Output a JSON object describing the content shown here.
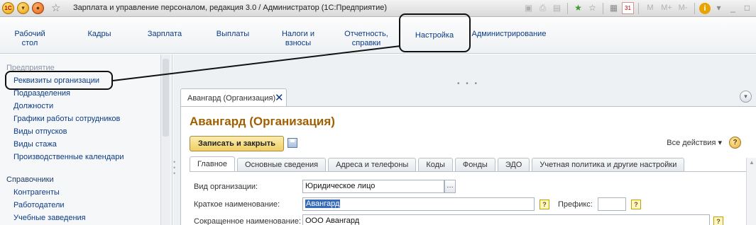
{
  "window": {
    "logo_text": "1С",
    "title": "Зарплата и управление персоналом, редакция 3.0 / Администратор  (1С:Предприятие)",
    "toolbar_m_labels": [
      "M",
      "M+",
      "M-"
    ]
  },
  "sections": [
    {
      "label_line1": "Рабочий",
      "label_line2": "стол"
    },
    {
      "label_line1": "Кадры",
      "label_line2": ""
    },
    {
      "label_line1": "Зарплата",
      "label_line2": ""
    },
    {
      "label_line1": "Выплаты",
      "label_line2": ""
    },
    {
      "label_line1": "Налоги и",
      "label_line2": "взносы"
    },
    {
      "label_line1": "Отчетность,",
      "label_line2": "справки"
    },
    {
      "label_line1": "Настройка",
      "label_line2": ""
    },
    {
      "label_line1": "Администрирование",
      "label_line2": ""
    }
  ],
  "nav": {
    "group1": "Предприятие",
    "items1": [
      "Реквизиты организации",
      "Подразделения",
      "Должности",
      "Графики работы сотрудников",
      "Виды отпусков",
      "Виды стажа",
      "Производственные календари"
    ],
    "group2": "Справочники",
    "items2": [
      "Контрагенты",
      "Работодатели",
      "Учебные заведения"
    ]
  },
  "document": {
    "tab_label": "Авангард (Организация)",
    "title": "Авангард (Организация)",
    "save_close_label": "Записать и закрыть",
    "all_actions_label": "Все действия ▾",
    "tabs": [
      "Главное",
      "Основные сведения",
      "Адреса и телефоны",
      "Коды",
      "Фонды",
      "ЭДО",
      "Учетная политика и другие настройки"
    ],
    "fields": {
      "org_type_label": "Вид организации:",
      "org_type_value": "Юридическое лицо",
      "short_name_label": "Краткое наименование:",
      "short_name_value": "Авангард",
      "prefix_label": "Префикс:",
      "prefix_value": "",
      "abbrev_name_label": "Сокращенное наименование:",
      "abbrev_name_value": "ООО Авангард"
    }
  },
  "colors": {
    "accent_title": "#a05f00",
    "link": "#0b3b86",
    "save_button": "#efcf64",
    "selection": "#3569b9"
  }
}
